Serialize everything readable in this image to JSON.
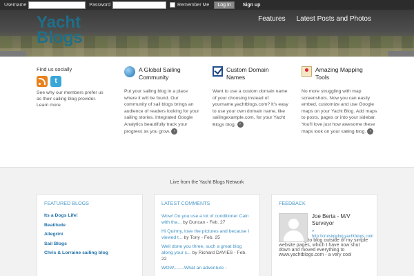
{
  "login": {
    "username_label": "Username",
    "password_label": "Password",
    "remember_label": "Remember Me",
    "login_button": "Log In",
    "signup_link": "Sign up"
  },
  "header": {
    "logo_line1": "Yacht",
    "logo_line2": "Blogs",
    "nav": [
      "Features",
      "Latest Posts and Photos"
    ]
  },
  "social": {
    "title": "Find us socially",
    "description": "See why our members prefer us as their sailing blog provider. Learn more"
  },
  "features": [
    {
      "icon": "globe-icon",
      "title": "A Global Sailing Community",
      "body": "Put your sailing blog in a place where it will be found. Our community of sail blogs brings an audience of readers looking for your sailing stories. Integrated Google Analytics beautifully track your progress as you grow."
    },
    {
      "icon": "checkbox-icon",
      "title": "Custom Domain Names",
      "body": "Want to use a custom domain name of your choosing instead of yourname.yachtblogs.com? It's easy to use your own domain name, like sailingexample.com, for your Yacht Blogs blog."
    },
    {
      "icon": "map-icon",
      "title": "Amazing Mapping Tools",
      "body": "No more struggling with map screenshots. Now you can easily embed, customize and use Google maps on your Yacht Blog. Add maps to posts, pages or into your sidebar. You'll love just how awesome these maps look on your sailing blog."
    }
  ],
  "network": {
    "live_label": "Live from the Yacht Blogs Network",
    "featured": {
      "title": "FEATURED BLOGS",
      "items": [
        "Its a Dogs Life!",
        "Beatitude",
        "Allegrini",
        "Sail Blogs",
        "Chris & Lorraine sailing blog"
      ]
    },
    "comments": {
      "title": "LATEST COMMENTS",
      "items": [
        {
          "link": "Wow! Do you use a lot of conditioner Cain with tha...",
          "by": " by Duncan - Feb. 27"
        },
        {
          "link": "Hi Quinny, love the pictures and because I viewed t...",
          "by": " by Tony - Feb. 25"
        },
        {
          "link": "Well done you three, such a great blog along your c...",
          "by": " by Richard DAVIES - Feb. 22"
        },
        {
          "link": "WOW........What an adventure -",
          "by": ""
        }
      ]
    },
    "feedback": {
      "title": "FEEDBACK",
      "name": "Joe Berta - M/V Surveyor",
      "url": "» http://cruisingdog.yachtblogs.com",
      "quote": "I am learning to blog outside of my simple website pages, which I have now shut down and moved everything to www.yachtblogs.com - a very cool"
    }
  },
  "colors": {
    "logo": "#1f6f8a",
    "link_blue": "#1f6fa8",
    "panel_title": "#4a9acb",
    "rss": "#e8821e",
    "twitter": "#3aa7d8"
  }
}
